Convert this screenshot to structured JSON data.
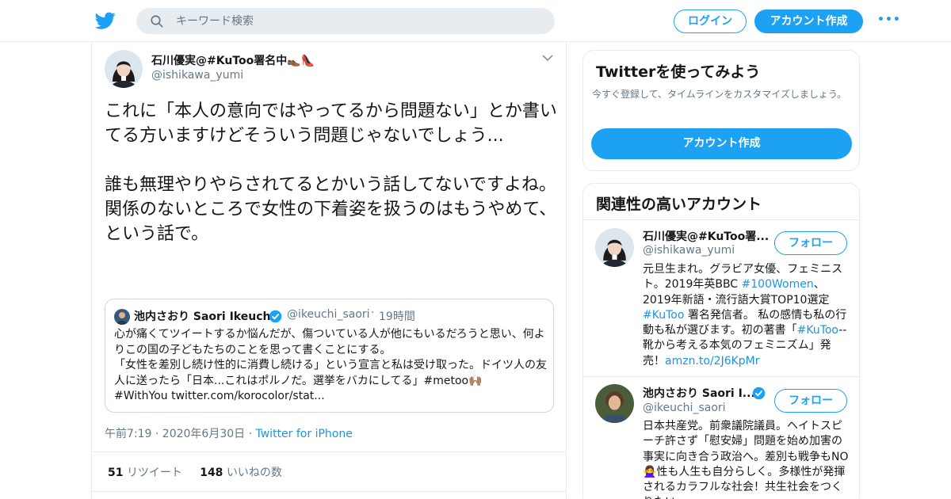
{
  "header": {
    "search_placeholder": "キーワード検索",
    "login_label": "ログイン",
    "signup_label": "アカウント作成",
    "more_label": "•••"
  },
  "tweet": {
    "author_name": "石川優実@#KuToo署名中👞👠",
    "author_handle": "@ishikawa_yumi",
    "text": "これに「本人の意向ではやってるから問題ない」とか書いてる方いますけどそういう問題じゃないでしょう...\n\n誰も無理やりやらされてるとかいう話してないですよね。\n関係のないところで女性の下着姿を扱うのはもうやめて、という話で。",
    "quote": {
      "name": "池内さおり Saori Ikeuchi",
      "handle": "@ikeuchi_saori",
      "dot": "·",
      "time": "19時間",
      "text": "心が痛くてツイートするか悩んだが、傷ついている人が他にもいるだろうと思い、何よりこの国の子どもたちのことを思って書くことにする。\n「女性を差別し続け性的に消費し続ける」という宣言と私は受け取った。ドイツ人の友人に送ったら「日本...これはポルノだ。選挙をバカにしてる」#metoo🙌🏽\n#WithYou twitter.com/korocolor/stat..."
    },
    "timestamp": "午前7:19 · 2020年6月30日",
    "meta_dot": "·",
    "source": "Twitter for iPhone",
    "retweets_count": "51",
    "retweets_label": "リツイート",
    "likes_count": "148",
    "likes_label": "いいねの数"
  },
  "signup_card": {
    "title": "Twitterを使ってみよう",
    "description": "今すぐ登録して、タイムラインをカスタマイズしましょう。",
    "button_label": "アカウント作成"
  },
  "related": {
    "title": "関連性の高いアカウント",
    "follow_label": "フォロー",
    "accounts": [
      {
        "name": "石川優実@#KuToo署...",
        "handle": "@ishikawa_yumi",
        "bio_1": "元旦生まれ。グラビア女優、フェミニスト。2019年英BBC ",
        "bio_link_1": "#100Women",
        "bio_2": "、2019年新語・流行語大賞TOP10選定 ",
        "bio_link_2": "#KuToo",
        "bio_3": " 署名発信者。 私の感情も私の行動も私が選びます。初の著書「",
        "bio_link_3": "#KuToo",
        "bio_4": "--靴から考える本気のフェミニズム」発売！",
        "bio_link_4": "amzn.to/2J6KpMr"
      },
      {
        "name": "池内さおり Saori I...",
        "handle": "@ikeuchi_saori",
        "bio": "日本共産党。前衆議院議員。ヘイトスピーチ許さず「慰安婦」問題を始め加害の事実に向き合う政治へ。差別も戦争もNO🙅‍♀️性も人生も自分らしく。多様性が発揮されるカラフルな社会！共生社会をつくりたい。"
      }
    ]
  },
  "colors": {
    "accent": "#1da1f2",
    "link": "#1b95e0",
    "muted": "#657786",
    "border": "#e6ecf0"
  },
  "icons": [
    "twitter-bird-icon",
    "search-icon",
    "chevron-down-icon",
    "verified-badge-icon"
  ]
}
